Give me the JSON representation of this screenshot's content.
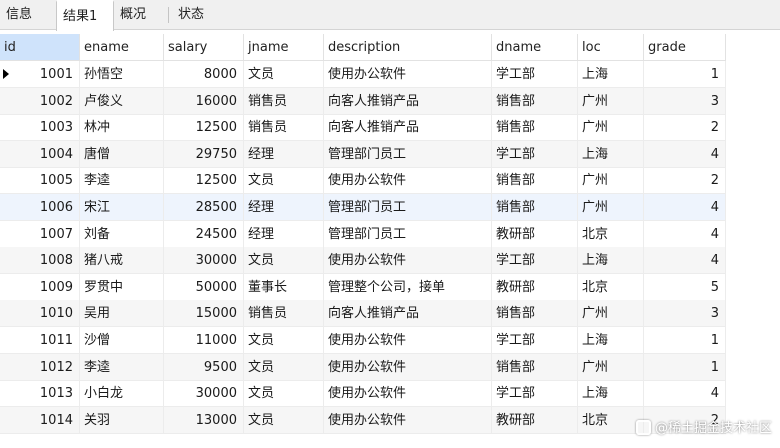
{
  "tabs": [
    {
      "label": "信息",
      "active": false
    },
    {
      "label": "结果1",
      "active": true
    },
    {
      "label": "概况",
      "active": false
    },
    {
      "label": "状态",
      "active": false
    }
  ],
  "table": {
    "columns": [
      "id",
      "ename",
      "salary",
      "jname",
      "description",
      "dname",
      "loc",
      "grade"
    ],
    "rows": [
      [
        "1001",
        "孙悟空",
        "8000",
        "文员",
        "使用办公软件",
        "学工部",
        "上海",
        "1"
      ],
      [
        "1002",
        "卢俊义",
        "16000",
        "销售员",
        "向客人推销产品",
        "销售部",
        "广州",
        "3"
      ],
      [
        "1003",
        "林冲",
        "12500",
        "销售员",
        "向客人推销产品",
        "销售部",
        "广州",
        "2"
      ],
      [
        "1004",
        "唐僧",
        "29750",
        "经理",
        "管理部门员工",
        "学工部",
        "上海",
        "4"
      ],
      [
        "1005",
        "李逵",
        "12500",
        "文员",
        "使用办公软件",
        "销售部",
        "广州",
        "2"
      ],
      [
        "1006",
        "宋江",
        "28500",
        "经理",
        "管理部门员工",
        "销售部",
        "广州",
        "4"
      ],
      [
        "1007",
        "刘备",
        "24500",
        "经理",
        "管理部门员工",
        "教研部",
        "北京",
        "4"
      ],
      [
        "1008",
        "猪八戒",
        "30000",
        "文员",
        "使用办公软件",
        "学工部",
        "上海",
        "4"
      ],
      [
        "1009",
        "罗贯中",
        "50000",
        "董事长",
        "管理整个公司，接单",
        "教研部",
        "北京",
        "5"
      ],
      [
        "1010",
        "吴用",
        "15000",
        "销售员",
        "向客人推销产品",
        "销售部",
        "广州",
        "3"
      ],
      [
        "1011",
        "沙僧",
        "11000",
        "文员",
        "使用办公软件",
        "学工部",
        "上海",
        "1"
      ],
      [
        "1012",
        "李逵",
        "9500",
        "文员",
        "使用办公软件",
        "销售部",
        "广州",
        "1"
      ],
      [
        "1013",
        "小白龙",
        "30000",
        "文员",
        "使用办公软件",
        "学工部",
        "上海",
        "4"
      ],
      [
        "1014",
        "关羽",
        "13000",
        "文员",
        "使用办公软件",
        "教研部",
        "北京",
        "2"
      ]
    ]
  },
  "watermark": "@稀土掘金技术社区"
}
